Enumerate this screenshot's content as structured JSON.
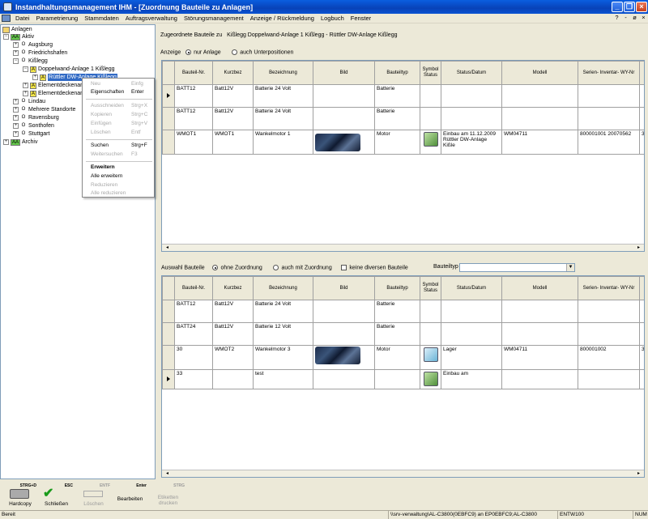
{
  "window": {
    "title": "Instandhaltungsmanagement IHM - [Zuordnung Bauteile zu Anlagen]"
  },
  "menu": {
    "items": [
      "Datei",
      "Parametrierung",
      "Stammdaten",
      "Auftragsverwaltung",
      "Störungsmanagement",
      "Anzeige / Rückmeldung",
      "Logbuch",
      "Fenster"
    ],
    "right": [
      "?",
      "-",
      "ø",
      "×"
    ]
  },
  "tree": {
    "root": "Anlagen",
    "nodes": [
      {
        "badge": "AA",
        "label": "Aktiv"
      },
      {
        "badge": "O",
        "label": "Augsburg"
      },
      {
        "badge": "O",
        "label": "Friedrichshafen"
      },
      {
        "badge": "O",
        "label": "Kißlegg"
      },
      {
        "badge": "A",
        "label": "Doppelwand-Anlage 1 Kißlegg"
      },
      {
        "badge": "A",
        "label": "Rüttler DW-Anlage Kißlegg"
      },
      {
        "badge": "A",
        "label": "Elementdeckenanlage"
      },
      {
        "badge": "A",
        "label": "Elementdeckenanlage"
      },
      {
        "badge": "O",
        "label": "Lindau"
      },
      {
        "badge": "O",
        "label": "Mehrere Standorte"
      },
      {
        "badge": "O",
        "label": "Ravensburg"
      },
      {
        "badge": "O",
        "label": "Sonthofen"
      },
      {
        "badge": "O",
        "label": "Stuttgart"
      },
      {
        "badge": "AA",
        "label": "Archiv"
      }
    ]
  },
  "context_menu": {
    "items": [
      {
        "label": "Neu",
        "shortcut": "Einfg",
        "enabled": false
      },
      {
        "label": "Eigenschaften",
        "shortcut": "Enter",
        "enabled": true
      },
      {
        "label": "Ausschneiden",
        "shortcut": "Strg+X",
        "enabled": false
      },
      {
        "label": "Kopieren",
        "shortcut": "Strg+C",
        "enabled": false
      },
      {
        "label": "Einfügen",
        "shortcut": "Strg+V",
        "enabled": false
      },
      {
        "label": "Löschen",
        "shortcut": "Entf",
        "enabled": false
      },
      {
        "label": "Suchen",
        "shortcut": "Strg+F",
        "enabled": true
      },
      {
        "label": "Weitersuchen",
        "shortcut": "F3",
        "enabled": false
      },
      {
        "label": "Erweitern",
        "shortcut": "",
        "enabled": true,
        "bold": true
      },
      {
        "label": "Alle erweitern",
        "shortcut": "",
        "enabled": true
      },
      {
        "label": "Reduzieren",
        "shortcut": "",
        "enabled": false
      },
      {
        "label": "Alle reduzieren",
        "shortcut": "",
        "enabled": false
      }
    ]
  },
  "top_panel": {
    "title_prefix": "Zugeordnete Bauteile zu",
    "title_path": "Kißlegg Doppelwand-Anlage 1 Kißlegg - Rüttler DW-Anlage Kißlegg",
    "anzeige_label": "Anzeige",
    "radio1": "nur Anlage",
    "radio2": "auch Unterpositionen",
    "columns": [
      "Bauteil-Nr.",
      "Kurzbez",
      "Bezeichnung",
      "Bild",
      "Bauteiltyp",
      "Symbol Status",
      "Status/Datum",
      "Modell",
      "Serien- Inventar- WY-Nr",
      "G"
    ],
    "rows": [
      {
        "nr": "BATT12",
        "kurz": "Batt12V",
        "bez": "Batterie 24 Volt",
        "typ": "Batterie",
        "status": "",
        "modell": "",
        "serien": "",
        "g": ""
      },
      {
        "nr": "BATT12",
        "kurz": "Batt12V",
        "bez": "Batterie 24 Volt",
        "typ": "Batterie",
        "status": "",
        "modell": "",
        "serien": "",
        "g": ""
      },
      {
        "nr": "WMOT1",
        "kurz": "WMOT1",
        "bez": "Wankelmotor 1",
        "typ": "Motor",
        "status": "Einbau am 11.12.2009 Rüttler DW-Anlage Kißle",
        "modell": "WM04711",
        "serien": "800001001 20070562",
        "g": "3"
      }
    ]
  },
  "bottom_panel": {
    "auswahl_label": "Auswahl Bauteile",
    "radio1": "ohne Zuordnung",
    "radio2": "auch mit Zuordnung",
    "checkbox": "keine diversen Bauteile",
    "bauteiltyp_label": "Bauteiltyp",
    "columns": [
      "Bauteil-Nr.",
      "Kurzbez",
      "Bezeichnung",
      "Bild",
      "Bauteiltyp",
      "Symbol Status",
      "Status/Datum",
      "Modell",
      "Serien- Inventar- WY-Nr",
      "G"
    ],
    "rows": [
      {
        "nr": "BATT12",
        "kurz": "Batt12V",
        "bez": "Batterie 24 Volt",
        "typ": "Batterie",
        "status": "",
        "modell": "",
        "serien": "",
        "g": ""
      },
      {
        "nr": "BATT24",
        "kurz": "Batt12V",
        "bez": "Batterie 12 Volt",
        "typ": "Batterie",
        "status": "",
        "modell": "",
        "serien": "",
        "g": ""
      },
      {
        "nr": "30",
        "kurz": "WMOT2",
        "bez": "Wankelmotor 3",
        "typ": "Motor",
        "status": "Lager",
        "modell": "WM04711",
        "serien": "800001002",
        "g": "3"
      },
      {
        "nr": "33",
        "kurz": "",
        "bez": "test",
        "typ": "",
        "status": "Einbau am",
        "modell": "",
        "serien": "",
        "g": ""
      }
    ]
  },
  "toolbar": {
    "buttons": [
      {
        "label": "Hardcopy",
        "key": "STRG+D",
        "enabled": true
      },
      {
        "label": "Schließen",
        "key": "ESC",
        "enabled": true
      },
      {
        "label": "Löschen",
        "key": "ENTF",
        "enabled": false
      },
      {
        "label": "Bearbeiten",
        "key": "Enter",
        "enabled": true
      },
      {
        "label": "Etiketten drucken",
        "key": "STRG",
        "enabled": false
      }
    ]
  },
  "status": {
    "left": "Bereit",
    "server": "\\\\srv-verwaltung\\AL-C3800(0EBFC9) an EP0EBFC9;AL-C3800",
    "user": "ENTW100",
    "num": "NUM"
  }
}
